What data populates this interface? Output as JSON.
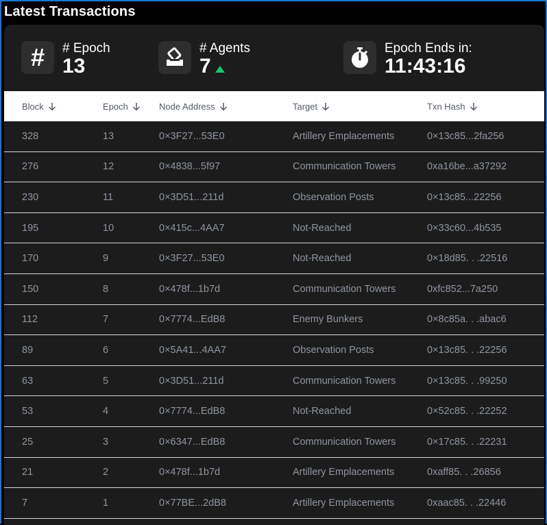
{
  "title": "Latest Transactions",
  "stats": {
    "epoch": {
      "label": "# Epoch",
      "value": "13",
      "icon": "hash-icon"
    },
    "agents": {
      "label": "# Agents",
      "value": "7",
      "icon": "ballot-box-icon",
      "trend": "up",
      "trend_color": "#1fc46a"
    },
    "ends": {
      "label": "Epoch Ends in:",
      "value": "11:43:16",
      "icon": "stopwatch-icon"
    }
  },
  "table": {
    "columns": [
      "Block",
      "Epoch",
      "Node Address",
      "Target",
      "Txn Hash"
    ],
    "rows": [
      [
        "328",
        "13",
        "0×3F27...53E0",
        "Artillery Emplacements",
        "0×13c85...2fa256"
      ],
      [
        "276",
        "12",
        "0×4838...5f97",
        "Communication Towers",
        "0xa16be...a37292"
      ],
      [
        "230",
        "11",
        "0×3D51...211d",
        "Observation Posts",
        "0×13c85...22256"
      ],
      [
        "195",
        "10",
        "0×415c...4AA7",
        "Not-Reached",
        "0×33c60...4b535"
      ],
      [
        "170",
        "9",
        "0×3F27...53E0",
        "Not-Reached",
        "0×18d85. . .22516"
      ],
      [
        "150",
        "8",
        "0×478f...1b7d",
        "Communication Towers",
        "0xfc852...7a250"
      ],
      [
        "112",
        "7",
        "0×7774...EdB8",
        "Enemy Bunkers",
        "0×8c85a. . .abac6"
      ],
      [
        "89",
        "6",
        "0×5A41...4AA7",
        "Observation Posts",
        "0×13c85. . .22256"
      ],
      [
        "63",
        "5",
        "0×3D51...211d",
        "Communication Towers",
        "0×13c85. . .99250"
      ],
      [
        "53",
        "4",
        "0×7774...EdB8",
        "Not-Reached",
        "0×52c85. . .22252"
      ],
      [
        "25",
        "3",
        "0×6347...EdB8",
        "Communication Towers",
        "0×17c85. . .22231"
      ],
      [
        "21",
        "2",
        "0×478f...1b7d",
        "Artillery Emplacements",
        "0xaff85. . .26856"
      ],
      [
        "7",
        "1",
        "0×77BE...2dB8",
        "Artillery Emplacements",
        "0xaac85. . .22446"
      ]
    ]
  },
  "colors": {
    "accent_border": "#1b76d6",
    "panel": "#1c1c1c",
    "header_bg": "#ffffff",
    "cell_text": "#8f95a0"
  }
}
